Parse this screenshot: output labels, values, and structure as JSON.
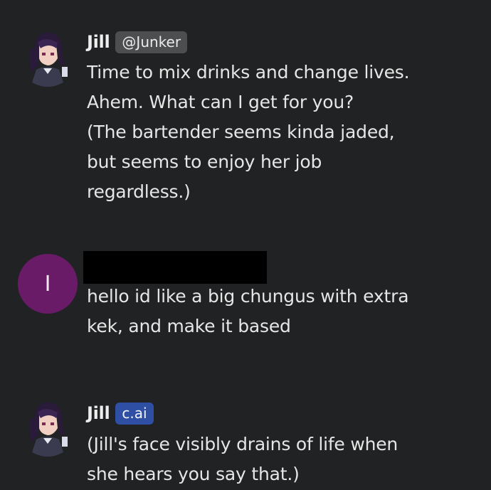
{
  "messages": [
    {
      "author": "Jill",
      "badge": "@Junker",
      "text": "Time to mix drinks and change lives.\nAhem. What can I get for you?\n(The bartender seems kinda jaded,\nbut seems to enjoy her job\nregardless.)"
    },
    {
      "avatar_initial": "I",
      "author": "",
      "text": "hello id like a big chungus with extra\nkek, and make it based"
    },
    {
      "author": "Jill",
      "badge": "c.ai",
      "text": "(Jill's face visibly drains of life when\nshe hears you say that.)"
    }
  ],
  "colors": {
    "background": "#212223",
    "user_avatar": "#6a1b68",
    "handle_badge": "#4d4e50",
    "cai_badge": "#2e4fa3"
  },
  "icons": {
    "character_avatar": "pixel-girl-avatar-icon"
  }
}
